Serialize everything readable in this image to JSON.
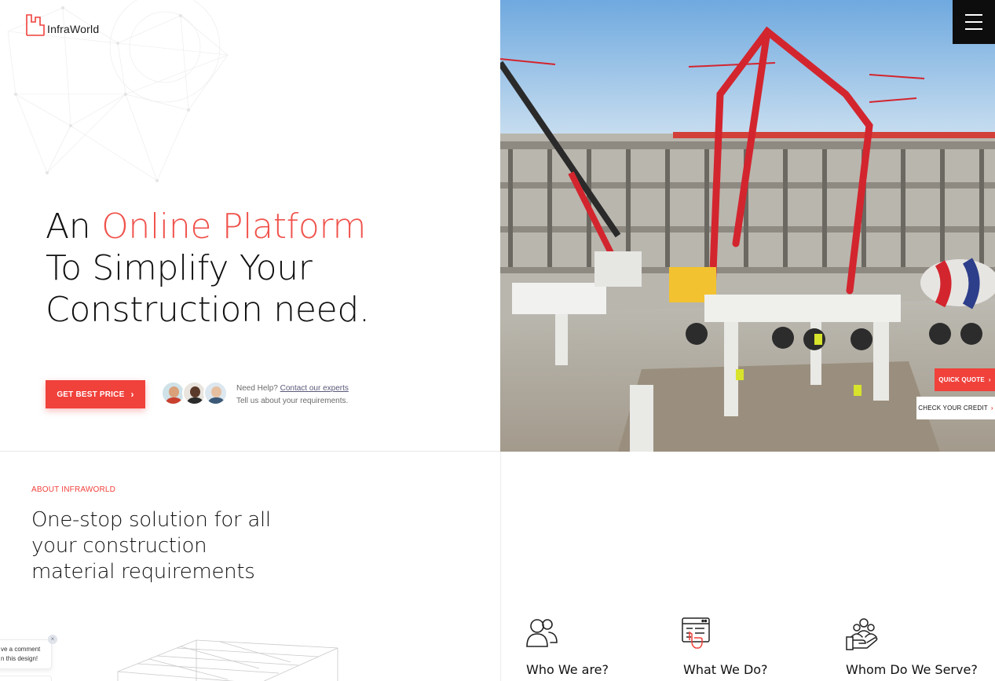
{
  "brand": {
    "name": "InfraWorld",
    "accent_color": "#f0413b"
  },
  "hero": {
    "headline_line1_prefix": "An ",
    "headline_line1_accent": "Online Platform",
    "headline_line2": "To Simplify Your",
    "headline_line3": "Construction need.",
    "cta_label": "GET BEST PRICE",
    "cta_icon": "chevron-right-icon",
    "help_prefix": "Need Help? ",
    "help_link": "Contact our experts",
    "help_line2": "Tell us about your requirements."
  },
  "header": {
    "menu_icon": "hamburger-menu-icon"
  },
  "side_buttons": {
    "quick_quote": "QUICK QUOTE",
    "check_credit": "CHECK YOUR CREDIT"
  },
  "about": {
    "eyebrow": "ABOUT INFRAWORLD",
    "title": "One-stop solution for all your construction material requirements"
  },
  "features": [
    {
      "label": "Who We are?",
      "icon": "people-icon"
    },
    {
      "label": "What We Do?",
      "icon": "browser-click-icon"
    },
    {
      "label": "Whom Do We Serve?",
      "icon": "hand-people-icon"
    }
  ],
  "comment_widget": {
    "line1": "ve a comment",
    "line2": "n this design!",
    "close": "×"
  }
}
